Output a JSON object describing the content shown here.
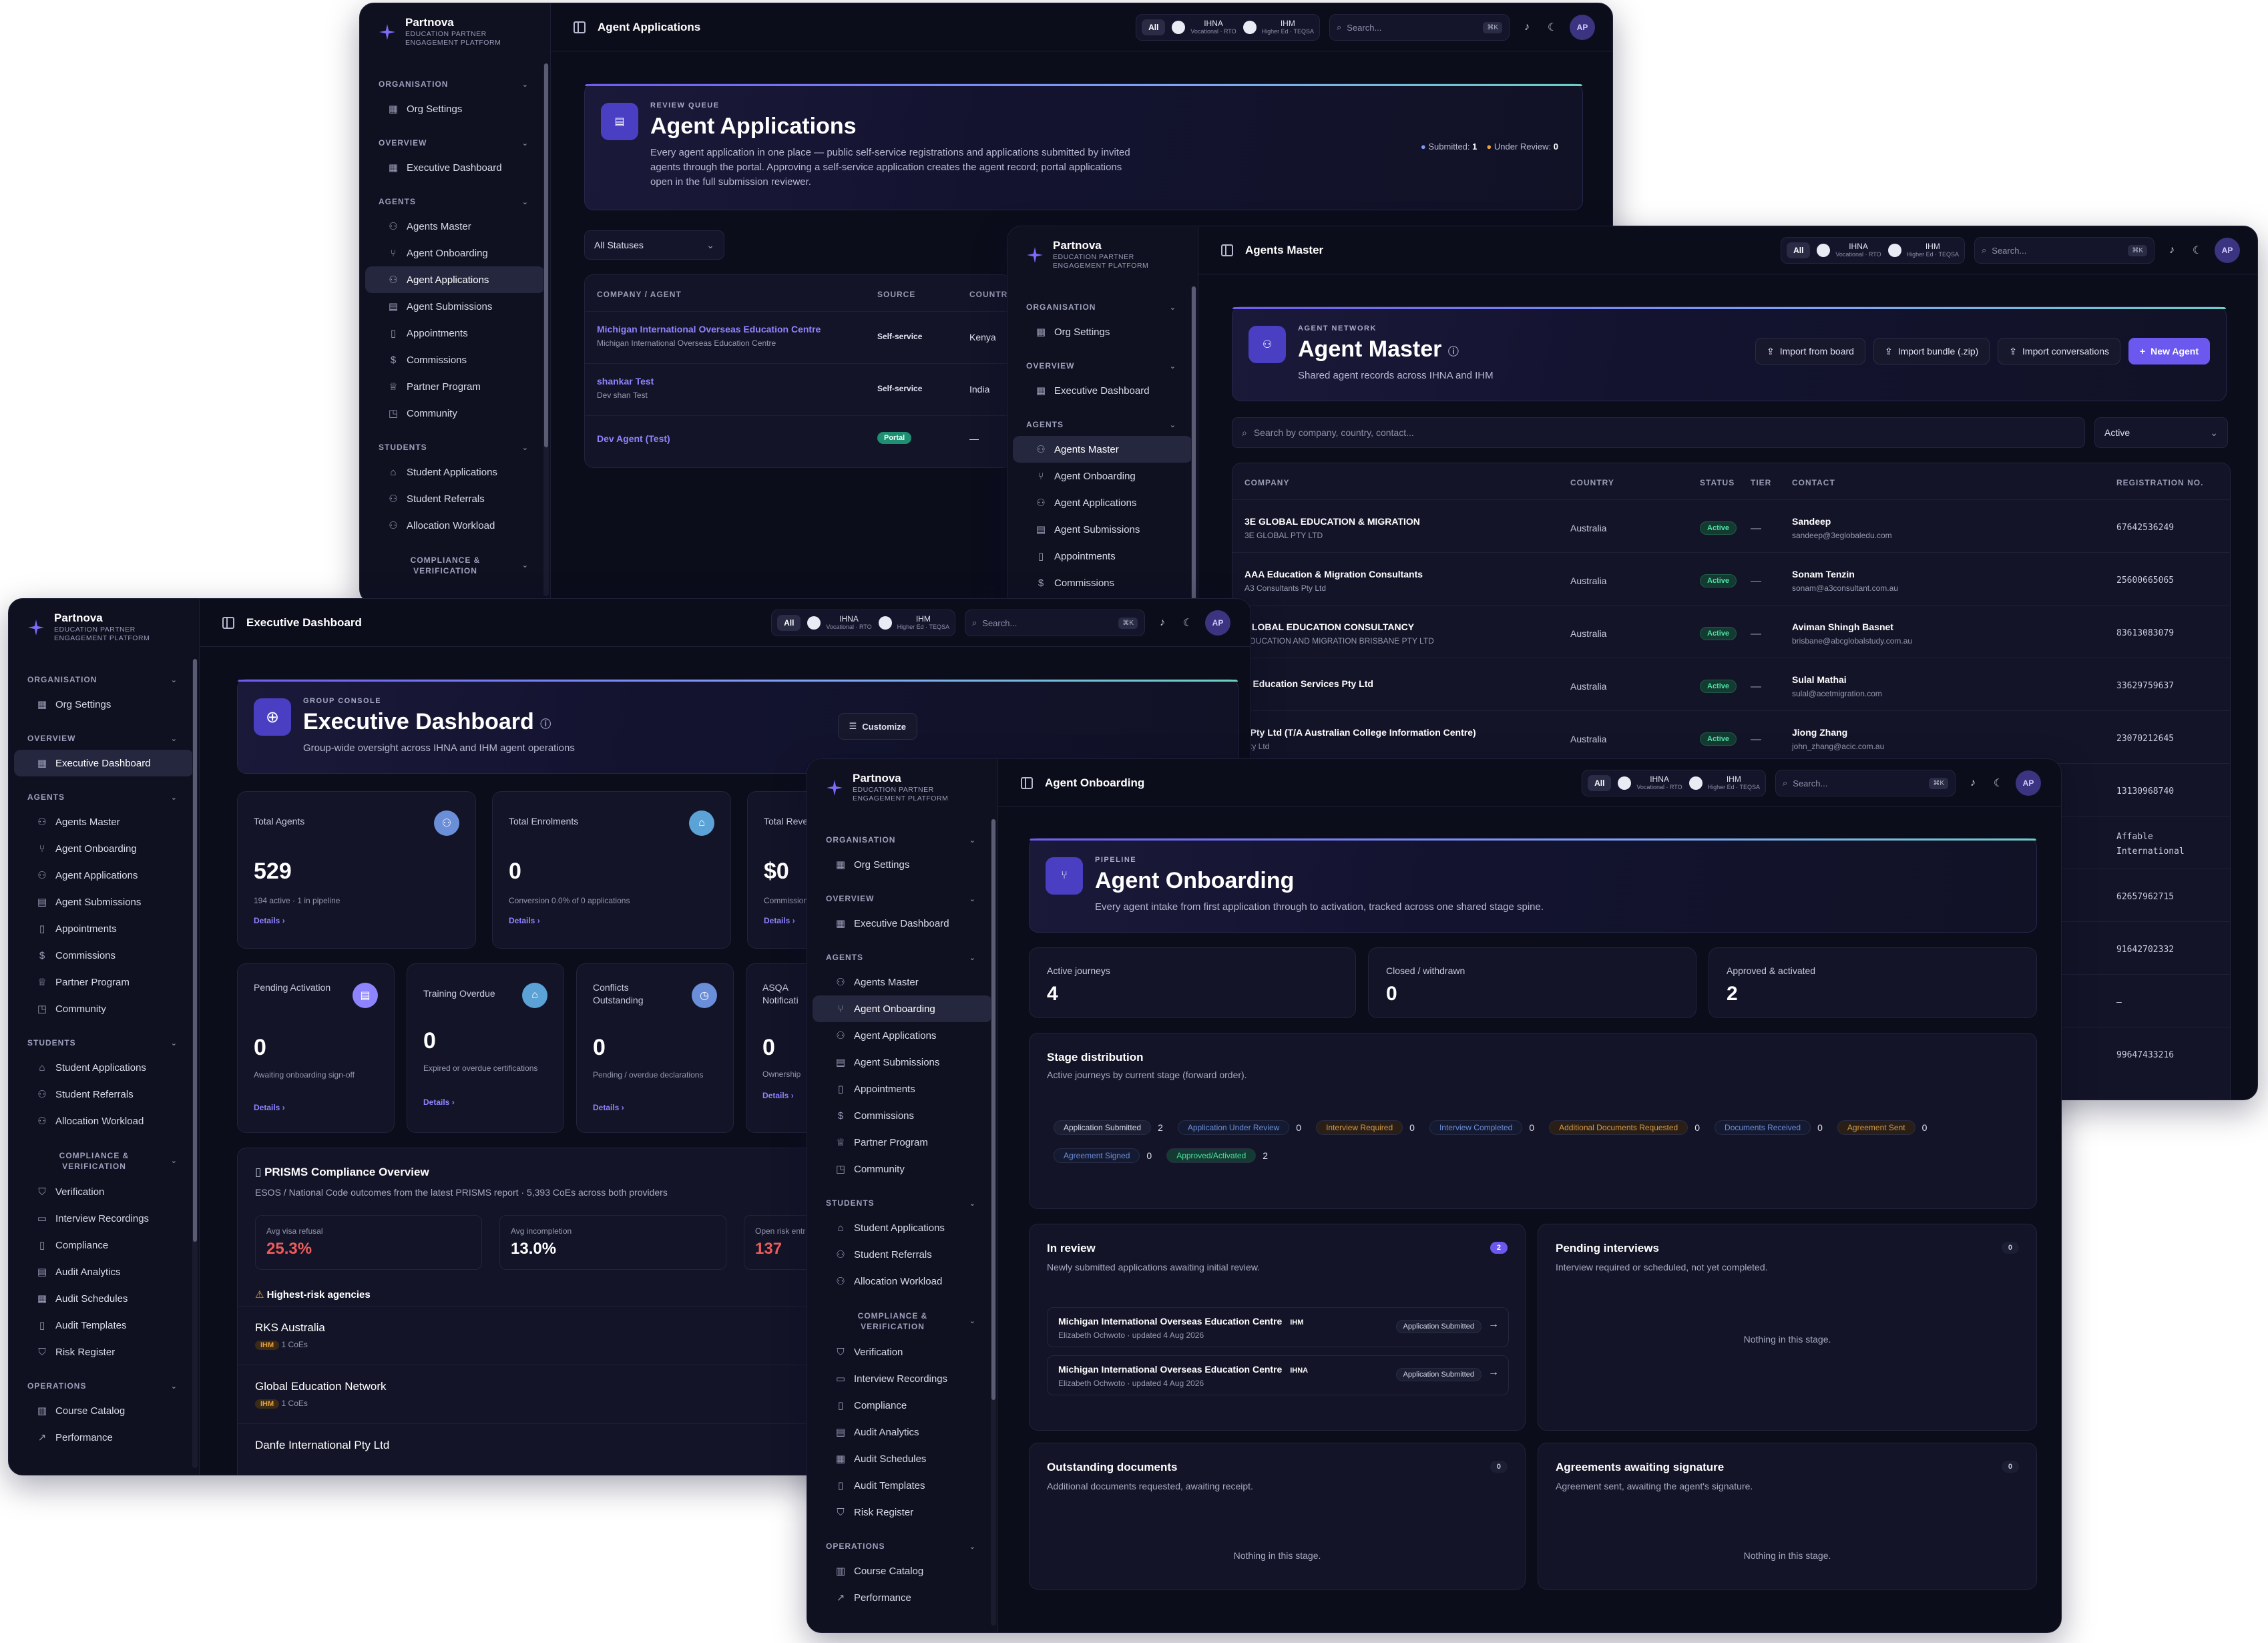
{
  "brand": {
    "name": "Partnova",
    "subtitle": "EDUCATION PARTNER ENGAGEMENT PLATFORM"
  },
  "topbar": {
    "all_label": "All",
    "org1_name": "IHNA",
    "org1_sub": "Vocational · RTO",
    "org2_name": "IHM",
    "org2_sub": "Higher Ed · TEQSA",
    "search_placeholder": "Search...",
    "search_shortcut": "⌘K",
    "avatar": "AP"
  },
  "nav": {
    "organisation": "ORGANISATION",
    "org_settings": "Org Settings",
    "overview": "OVERVIEW",
    "executive_dashboard": "Executive Dashboard",
    "agents": "AGENTS",
    "agents_master": "Agents Master",
    "agent_onboarding": "Agent Onboarding",
    "agent_applications": "Agent Applications",
    "agent_submissions": "Agent Submissions",
    "appointments": "Appointments",
    "commissions": "Commissions",
    "partner_program": "Partner Program",
    "community": "Community",
    "students": "STUDENTS",
    "student_applications": "Student Applications",
    "student_referrals": "Student Referrals",
    "allocation_workload": "Allocation Workload",
    "compliance": "COMPLIANCE & VERIFICATION",
    "verification": "Verification",
    "interview_recordings": "Interview Recordings",
    "compliance_item": "Compliance",
    "audit_analytics": "Audit Analytics",
    "audit_schedules": "Audit Schedules",
    "audit_templates": "Audit Templates",
    "risk_register": "Risk Register",
    "operations": "OPERATIONS",
    "course_catalog": "Course Catalog",
    "performance": "Performance"
  },
  "applications": {
    "page_title": "Agent Applications",
    "kicker": "REVIEW QUEUE",
    "title": "Agent Applications",
    "description_1": "Every agent application in one place — public self-service registrations and applications submitted by invited",
    "description_2": "agents through the portal. Approving a self-service application creates the agent record; portal applications",
    "description_3": "open in the full submission reviewer.",
    "submitted": "Submitted:",
    "submitted_count": "1",
    "under_review": "Under Review:",
    "under_review_count": "0",
    "filter": "All Statuses",
    "columns": {
      "company": "COMPANY / AGENT",
      "source": "SOURCE",
      "country": "COUNTRY"
    },
    "rows": [
      {
        "company": "Michigan International Overseas Education Centre",
        "agent": "Michigan International Overseas Education Centre",
        "source": "Self-service",
        "country": "Kenya"
      },
      {
        "company": "shankar Test",
        "agent": "Dev shan Test",
        "source": "Self-service",
        "country": "India"
      },
      {
        "company": "Dev Agent (Test)",
        "agent": "",
        "source": "Portal",
        "country": "—"
      }
    ]
  },
  "master": {
    "page_title": "Agents Master",
    "kicker": "AGENT NETWORK",
    "title": "Agent Master",
    "description": "Shared agent records across IHNA and IHM",
    "import_board": "Import from board",
    "import_bundle": "Import bundle (.zip)",
    "import_conv": "Import conversations",
    "new_agent": "New Agent",
    "search_placeholder": "Search by company, country, contact...",
    "status_filter": "Active",
    "columns": {
      "company": "COMPANY",
      "country": "COUNTRY",
      "status": "STATUS",
      "tier": "TIER",
      "contact": "CONTACT",
      "reg": "REGISTRATION NO."
    },
    "rows": [
      {
        "company": "3E GLOBAL EDUCATION & MIGRATION",
        "legal": "3E GLOBAL PTY LTD",
        "country": "Australia",
        "status": "Active",
        "tier": "—",
        "contact": "Sandeep",
        "email": "sandeep@3eglobaledu.com",
        "reg": "67642536249"
      },
      {
        "company": "AAA Education & Migration Consultants",
        "legal": "A3 Consultants Pty Ltd",
        "country": "Australia",
        "status": "Active",
        "tier": "—",
        "contact": "Sonam Tenzin",
        "email": "sonam@a3consultant.com.au",
        "reg": "25600665065"
      },
      {
        "company": "GLOBAL EDUCATION CONSULTANCY",
        "legal": "EDUCATION AND MIGRATION BRISBANE PTY LTD",
        "country": "Australia",
        "status": "Active",
        "tier": "—",
        "contact": "Aviman Shingh Basnet",
        "email": "brisbane@abcglobalstudy.com.au",
        "reg": "83613083079"
      },
      {
        "company": "T Education Services Pty Ltd",
        "legal": "",
        "country": "Australia",
        "status": "Active",
        "tier": "—",
        "contact": "Sulal Mathai",
        "email": "sulal@acetmigration.com",
        "reg": "33629759637"
      },
      {
        "company": ": Pty Ltd (T/A Australian College Information Centre)",
        "legal": "Pty Ltd",
        "country": "Australia",
        "status": "Active",
        "tier": "—",
        "contact": "Jiong Zhang",
        "email": "john_zhang@acic.com.au",
        "reg": "23070212645"
      }
    ],
    "extra_regs": [
      "13130968740",
      "Affable",
      "International",
      "62657962715",
      "91642702332",
      "–",
      "99647433216"
    ]
  },
  "exec": {
    "page_title": "Executive Dashboard",
    "kicker": "GROUP CONSOLE",
    "title": "Executive Dashboard",
    "description": "Group-wide oversight across IHNA and IHM agent operations",
    "customize": "Customize",
    "kpi1": {
      "label": "Total Agents",
      "value": "529",
      "sub": "194 active · 1 in pipeline",
      "link": "Details"
    },
    "kpi2": {
      "label": "Total Enrolments",
      "value": "0",
      "sub": "Conversion 0.0% of 0 applications",
      "link": "Details"
    },
    "kpi3": {
      "label": "Total Reve",
      "value": "$0",
      "sub": "Commission",
      "link": "Details"
    },
    "kpi4": {
      "label": "Pending Activation",
      "value": "0",
      "sub": "Awaiting onboarding sign-off",
      "link": "Details"
    },
    "kpi5": {
      "label": "Training Overdue",
      "value": "0",
      "sub": "Expired or overdue certifications",
      "link": "Details"
    },
    "kpi6": {
      "label": "Conflicts Outstanding",
      "value": "0",
      "sub": "Pending / overdue declarations",
      "link": "Details"
    },
    "kpi7": {
      "label": "ASQA Notificati",
      "value": "0",
      "sub": "Ownership",
      "link": "Details"
    },
    "prisms_title": "PRISMS Compliance Overview",
    "prisms_desc": "ESOS / National Code outcomes from the latest PRISMS report · 5,393 CoEs across both providers",
    "m1_label": "Avg visa refusal",
    "m1_value": "25.3%",
    "m2_label": "Avg incompletion",
    "m2_value": "13.0%",
    "m3_label": "Open risk entr",
    "m3_value": "137",
    "risk_title": "Highest-risk agencies",
    "agencies": [
      {
        "name": "RKS Australia",
        "tag": "IHM",
        "coes": "1 CoEs"
      },
      {
        "name": "Global Education Network",
        "tag": "IHM",
        "coes": "1 CoEs"
      },
      {
        "name": "Danfe International Pty Ltd",
        "tag": "",
        "coes": ""
      }
    ]
  },
  "onb": {
    "page_title": "Agent Onboarding",
    "kicker": "PIPELINE",
    "title": "Agent Onboarding",
    "description": "Every agent intake from first application through to activation, tracked across one shared stage spine.",
    "s1_label": "Active journeys",
    "s1_value": "4",
    "s2_label": "Closed / withdrawn",
    "s2_value": "0",
    "s3_label": "Approved & activated",
    "s3_value": "2",
    "dist_title": "Stage distribution",
    "dist_desc": "Active journeys by current stage (forward order).",
    "stages": [
      {
        "name": "Application Submitted",
        "n": "2",
        "color": "#d9dbea",
        "bg": "#1c1e33"
      },
      {
        "name": "Application Under Review",
        "n": "0",
        "color": "#6d8fd6",
        "bg": "#151a33"
      },
      {
        "name": "Interview Required",
        "n": "0",
        "color": "#d39a4d",
        "bg": "#2a1f16"
      },
      {
        "name": "Interview Completed",
        "n": "0",
        "color": "#6d8fd6",
        "bg": "#151a33"
      },
      {
        "name": "Additional Documents Requested",
        "n": "0",
        "color": "#d39a4d",
        "bg": "#2a1f16"
      },
      {
        "name": "Documents Received",
        "n": "0",
        "color": "#6d8fd6",
        "bg": "#151a33"
      },
      {
        "name": "Agreement Sent",
        "n": "0",
        "color": "#d39a4d",
        "bg": "#2a1f16"
      },
      {
        "name": "Agreement Signed",
        "n": "0",
        "color": "#6d8fd6",
        "bg": "#151a33"
      },
      {
        "name": "Approved/Activated",
        "n": "2",
        "color": "#4ee0a6",
        "bg": "#143b31"
      }
    ],
    "inreview_title": "In review",
    "inreview_count": "2",
    "inreview_desc": "Newly submitted applications awaiting initial review.",
    "review_items": [
      {
        "name": "Michigan International Overseas Education Centre",
        "tag": "IHM",
        "meta": "Elizabeth Ochwoto · updated 4 Aug 2026",
        "status": "Application Submitted"
      },
      {
        "name": "Michigan International Overseas Education Centre",
        "tag": "IHNA",
        "meta": "Elizabeth Ochwoto · updated 4 Aug 2026",
        "status": "Application Submitted"
      }
    ],
    "pi_title": "Pending interviews",
    "pi_count": "0",
    "pi_desc": "Interview required or scheduled, not yet completed.",
    "empty": "Nothing in this stage.",
    "od_title": "Outstanding documents",
    "od_count": "0",
    "od_desc": "Additional documents requested, awaiting receipt.",
    "ag_title": "Agreements awaiting signature",
    "ag_count": "0",
    "ag_desc": "Agreement sent, awaiting the agent's signature."
  }
}
